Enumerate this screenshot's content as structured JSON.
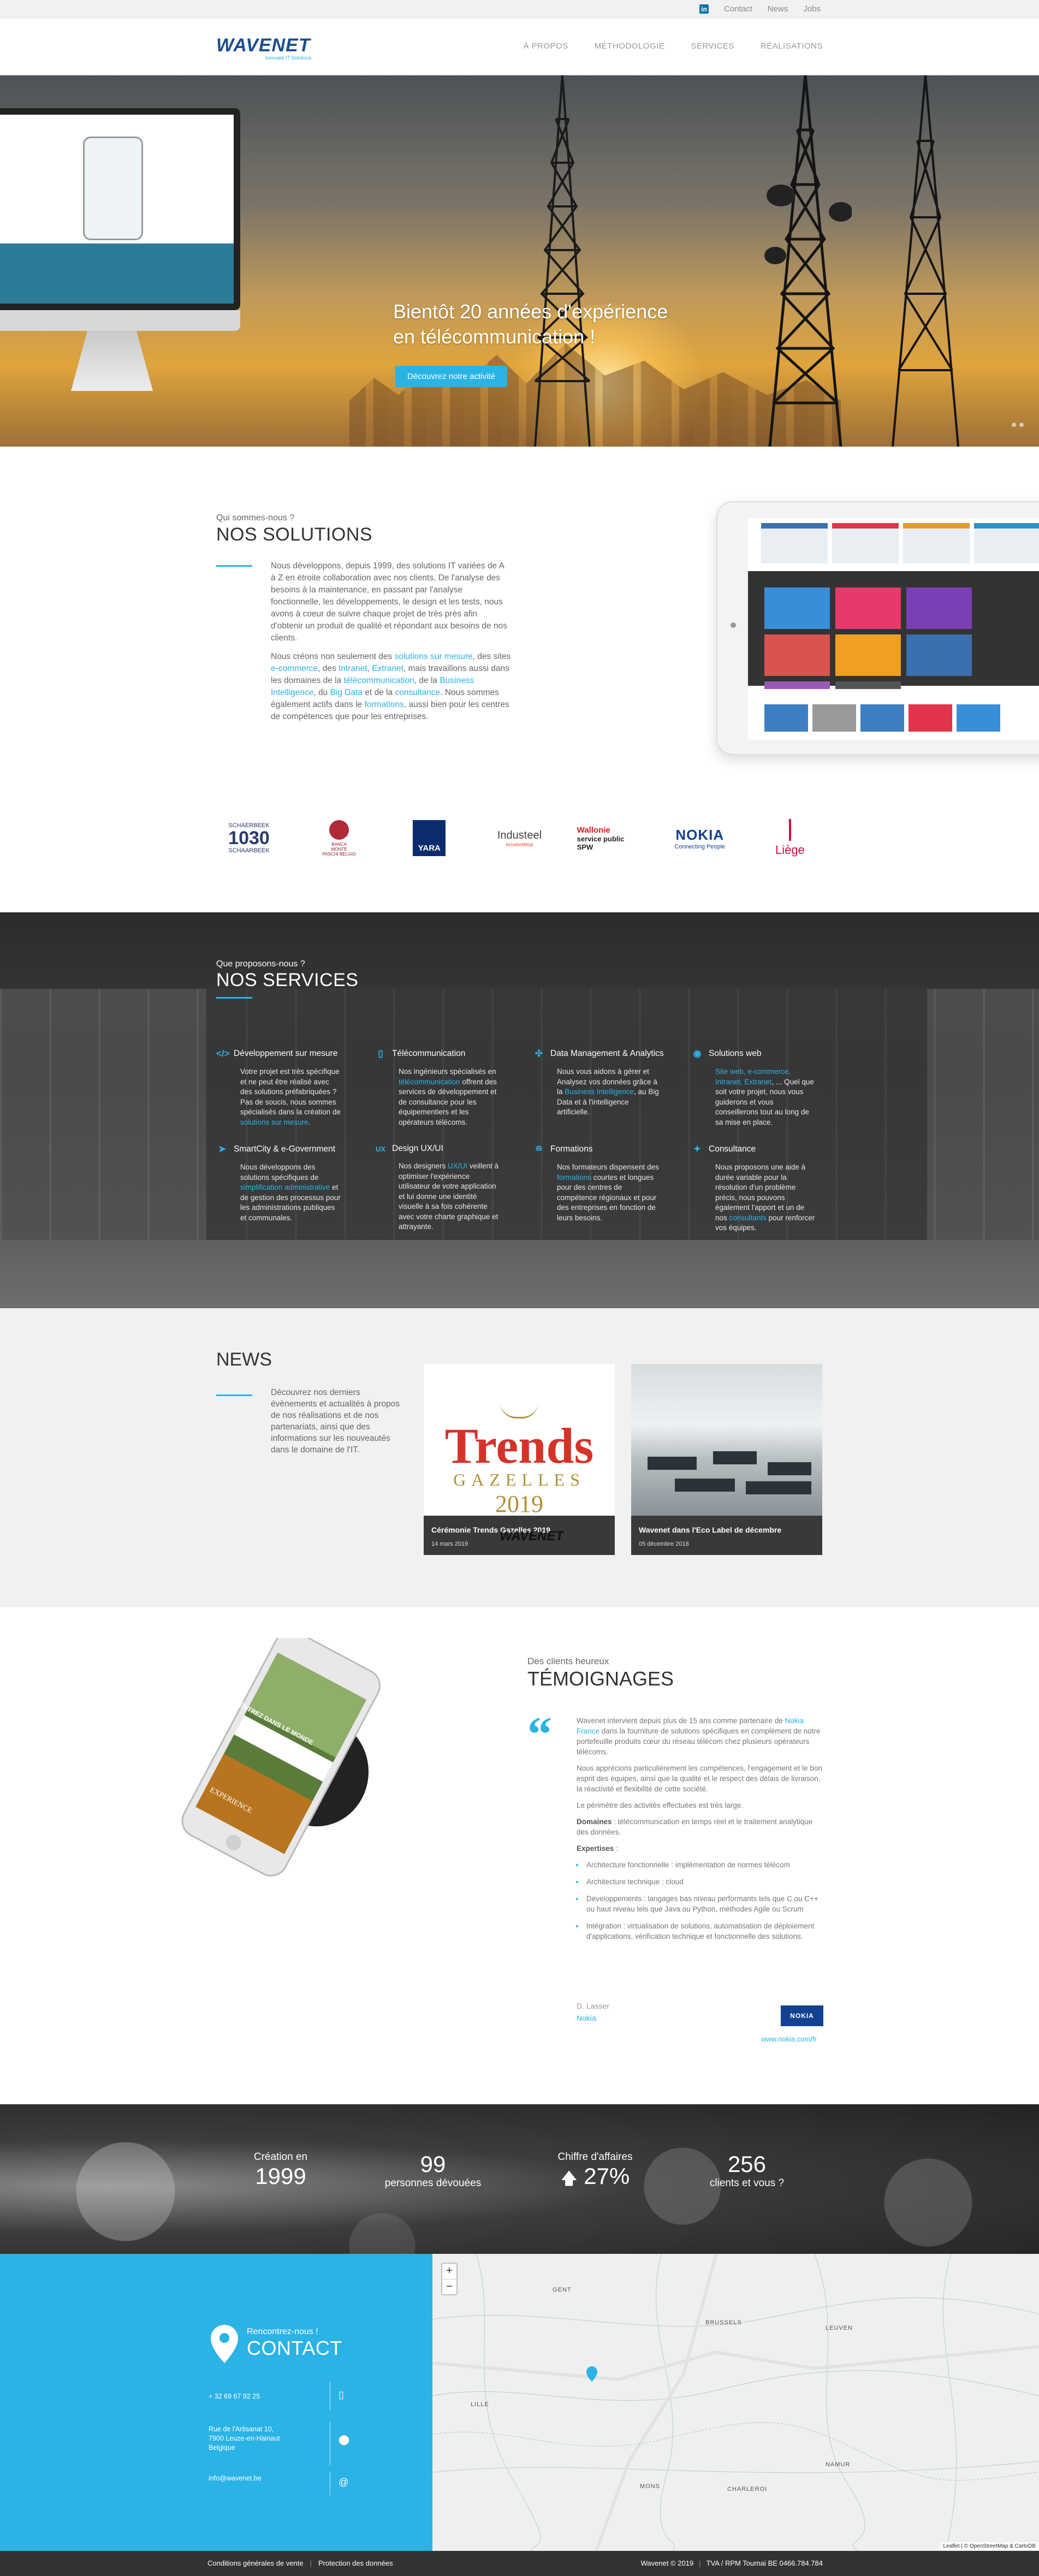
{
  "topbar": {
    "links": [
      "Contact",
      "News",
      "Jobs"
    ]
  },
  "header": {
    "logo": "WAVENET",
    "logo_tagline": "Innovate IT Solutions",
    "nav": [
      "À PROPOS",
      "MÉTHODOLOGIE",
      "SERVICES",
      "RÉALISATIONS"
    ]
  },
  "hero": {
    "headline_1": "Bientôt 20 années d'expérience",
    "headline_2": "en télécommunication !",
    "cta": "Découvrez notre activité"
  },
  "solutions": {
    "kicker": "Qui sommes-nous ?",
    "title": "NOS SOLUTIONS",
    "p1": "Nous développons, depuis 1999, des solutions IT variées de A à Z en étroite collaboration avec nos clients. De l'analyse des besoins à la maintenance, en passant par l'analyse fonctionnelle, les développements, le design et les tests, nous avons à coeur de suivre chaque projet de très près afin d'obtenir un produit de qualité et répondant aux besoins de nos clients.",
    "p2_a": "Nous créons non seulement des ",
    "p2_link1": "solutions sur mesure",
    "p2_b": ", des sites ",
    "p2_link2": "e-commerce",
    "p2_c": ", des ",
    "p2_link3": "Intranet",
    "p2_d": ", ",
    "p2_link4": "Extranet",
    "p2_e": ", mais travaillons aussi dans les domaines de la ",
    "p2_link5": "télécommunication",
    "p2_f": ", de la ",
    "p2_link6": "Business Intelligence",
    "p2_g": ", du ",
    "p2_link7": "Big Data",
    "p2_h": " et de la ",
    "p2_link8": "consultance",
    "p2_i": ". Nous sommes également actifs dans le ",
    "p2_link9": "formations",
    "p2_j": ", aussi bien pour les centres de compétences que pour les entreprises."
  },
  "client_logos": [
    {
      "name": "SCHAERBEEK 1030 SCHAARBEEK",
      "line1": "SCHAERBEEK",
      "line2": "1030",
      "line3": "SCHAARBEEK"
    },
    {
      "name": "BANCA MONTE PASCHI BELGIO",
      "line1": "BANCA",
      "line2": "MONTE",
      "line3": "PASCHI BELGIO"
    },
    {
      "name": "YARA",
      "line1": "YARA"
    },
    {
      "name": "Industeel",
      "line1": "Industeel",
      "line2": "ArcelorMittal"
    },
    {
      "name": "Wallonie service public SPW",
      "line1": "Wallonie",
      "line2": "service public",
      "line3": "SPW"
    },
    {
      "name": "NOKIA Connecting People",
      "line1": "NOKIA",
      "line2": "Connecting People"
    },
    {
      "name": "Liège",
      "line1": "Liège"
    }
  ],
  "services": {
    "kicker": "Que proposons-nous ?",
    "title": "NOS SERVICES",
    "items": [
      {
        "icon": "code-icon",
        "glyph": "</>",
        "title": "Développement sur mesure",
        "body": "Votre projet est très spécifique et ne peut être réalisé avec des solutions préfabriquées ? Pas de soucis, nous sommes spécialisés dans la création de ",
        "link": "solutions sur mesure",
        "after": "."
      },
      {
        "icon": "mobile-icon",
        "glyph": "▯",
        "title": "Télécommunication",
        "body": "Nos ingénieurs spécialisés en ",
        "link": "télécommunication",
        "after": " offrent des services de développement et de consultance pour les équipementiers et les opérateurs télécoms."
      },
      {
        "icon": "network-icon",
        "glyph": "✣",
        "title": "Data Management & Analytics",
        "body": "Analysez vos données grâce à la ",
        "link": "Business Intelligence",
        "after": ", au Big Data et à l'intelligence artificielle.",
        "prefix": "Nous vous aidons à gérer et "
      },
      {
        "icon": "globe-icon",
        "glyph": "◉",
        "title": "Solutions web",
        "body": "",
        "link": "Site web, e-commerce, Intranet, Extranet",
        "after": ", ... Quel que soit votre projet, nous vous guiderons et vous conseillerons tout au long de sa mise en place."
      },
      {
        "icon": "paper-plane-icon",
        "glyph": "➤",
        "title": "SmartCity & e-Government",
        "body": "Nous développons des solutions spécifiques de ",
        "link": "simplification administrative",
        "after": " et de gestion des processus pour les administrations publiques et communales."
      },
      {
        "icon": "ux-icon",
        "glyph": "UX",
        "title": "Design UX/UI",
        "body": "Nos designers ",
        "link": "UX/UI",
        "after": " veillent à optimiser l'expérience utilisateur de votre application et lui donne une identité visuelle à sa fois cohérente avec votre charte graphique et attrayante."
      },
      {
        "icon": "graduation-cap-icon",
        "glyph": "🎓",
        "title": "Formations",
        "body": "Nos formateurs dispensent des ",
        "link": "formations",
        "after": " courtes et longues pour des centres de compétence régionaux et pour des entreprises en fonction de leurs besoins."
      },
      {
        "icon": "consulting-icon",
        "glyph": "✦",
        "title": "Consultance",
        "body": "Nous proposons une aide à durée variable pour la résolution d'un problème précis, nous pouvons également l'apport et un de nos ",
        "link": "consultants",
        "after": " pour renforcer vos équipes."
      }
    ]
  },
  "news": {
    "title": "NEWS",
    "intro": "Découvrez nos derniers évènements et actualités à propos de nos réalisations et de nos partenariats, ainsi que des informations sur les nouveautés dans le domaine de l'IT.",
    "cards": [
      {
        "title": "Cérémonie Trends Gazelles 2019",
        "date": "14 mars 2019",
        "art_1": "Trends",
        "art_2": "GAZELLES",
        "art_3": "2019",
        "watermark": "WAVENET"
      },
      {
        "title": "Wavenet dans l'Eco Label de décembre",
        "date": "05 décembre 2018"
      }
    ]
  },
  "testimonials": {
    "kicker": "Des clients heureux",
    "title": "TÉMOIGNAGES",
    "p1_a": "Wavenet intervient depuis plus de 15 ans comme partenaire de ",
    "p1_link": "Nokia France",
    "p1_b": " dans la fourniture de solutions spécifiques en complément de notre portefeuille produits cœur du réseau télécom chez plusieurs opérateurs télécoms.",
    "p2": "Nous apprécions particulièrement les compétences, l'engagement et le bon esprit des équipes, ainsi que la qualité et le respect des délais de livraison, la réactivité et flexibilité de cette société.",
    "p3": "Le périmètre des activités effectuées est très large.",
    "p4_label": "Domaines",
    "p4_text": " : télécommunication en temps réel et le traitement analytique des données.",
    "p5_label": "Expertises",
    "p5_text": " :",
    "bullets": [
      "Architecture fonctionnelle : implémentation de normes télécom",
      "Architecture technique : cloud",
      "Développements : langages bas niveau performants tels que C ou C++ ou haut niveau tels que Java ou Python, méthodes Agile ou Scrum",
      "Intégration : virtualisation de solutions, automatisation de déploiement d'applications, vérification technique et fonctionnelle des solutions."
    ],
    "author": "D. Lasser",
    "company": "Nokia",
    "badge": "NOKIA",
    "url": "www.nokia.com/fr",
    "phone_screen_text": "ENTREZ DANS LE MONDE",
    "phone_screen_logo": "EXPERIENCE"
  },
  "stats": [
    {
      "label": "Création en",
      "value": "1999"
    },
    {
      "label": "personnes dévouées",
      "value": "99"
    },
    {
      "label": "Chiffre d'affaires",
      "value": "27%",
      "arrow": "🡅"
    },
    {
      "label": "clients et vous ?",
      "value": "256"
    }
  ],
  "contact": {
    "kicker": "Rencontrez-nous !",
    "title": "CONTACT",
    "phone": "+ 32 69 67 92 25",
    "address": [
      "Rue de l'Artisanat 10,",
      "7900 Leuze-en-Hainaut",
      "Belgique"
    ],
    "email": "info@wavenet.be"
  },
  "map": {
    "zoom_in": "+",
    "zoom_out": "−",
    "attribution": "Leaflet | © OpenStreetMap & CartoDB",
    "labels": [
      "BRUSSELS",
      "LILLE",
      "CHARLEROI",
      "NAMUR",
      "MONS",
      "LEUVEN",
      "GENT"
    ]
  },
  "footer": {
    "left": [
      "Conditions générales de vente",
      "Protection des données"
    ],
    "right": [
      "Wavenet © 2019",
      "TVA / RPM Tournai BE 0466.784.784"
    ]
  }
}
